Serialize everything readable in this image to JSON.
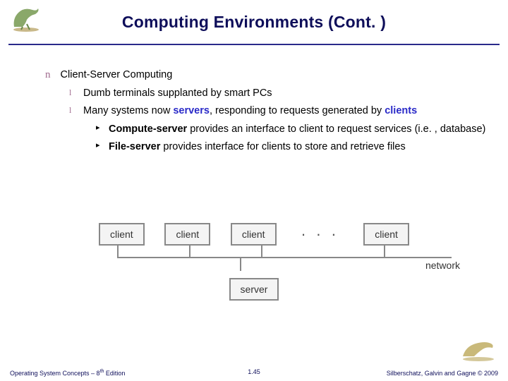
{
  "title": "Computing Environments (Cont. )",
  "bullets": {
    "l1": "Client-Server Computing",
    "l2a": "Dumb terminals supplanted by smart PCs",
    "l2b_pre": "Many systems now ",
    "l2b_kw1": "servers",
    "l2b_mid": ", responding to requests generated by ",
    "l2b_kw2": "clients",
    "l3a_kw": "Compute-server",
    "l3a_rest": " provides an interface to client to request services (i.e. , database)",
    "l3b_kw": "File-server",
    "l3b_rest": " provides interface for clients to store and retrieve files"
  },
  "diagram": {
    "client": "client",
    "server": "server",
    "network": "network",
    "dots": "· · ·"
  },
  "footer": {
    "left_pre": "Operating System Concepts – 8",
    "left_sup": "th",
    "left_post": " Edition",
    "center": "1.45",
    "right": "Silberschatz, Galvin and Gagne © 2009"
  }
}
